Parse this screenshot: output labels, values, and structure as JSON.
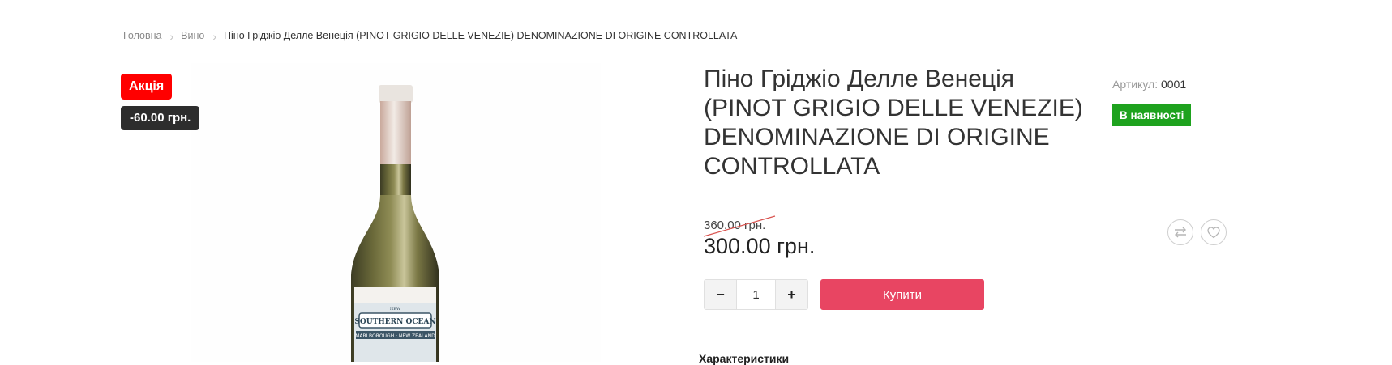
{
  "breadcrumb": {
    "home": "Головна",
    "category": "Вино",
    "current": "Піно Гріджіо Делле Венеція (PINOT GRIGIO DELLE VENEZIE) DENOMINAZIONE DI ORIGINE CONTROLLATA"
  },
  "badges": {
    "sale": "Акція",
    "discount": "-60.00 грн."
  },
  "product": {
    "title": "Піно Гріджіо Делле Венеція (PINOT GRIGIO DELLE VENEZIE) DENOMINAZIONE DI ORIGINE CONTROLLATA",
    "article_label": "Артикул:",
    "article_value": "0001",
    "stock_status": "В наявності",
    "old_price": "360.00 грн.",
    "new_price": "300.00 грн."
  },
  "cart": {
    "minus": "−",
    "plus": "+",
    "quantity": "1",
    "buy_label": "Купити"
  },
  "section": {
    "characteristics": "Характеристики"
  },
  "colors": {
    "sale_badge": "#ff0000",
    "discount_badge": "#2d2d2d",
    "stock_badge": "#1ea21e",
    "buy_button": "#e84562",
    "strike_line": "#d9534f"
  },
  "icons": {
    "compare": "compare-arrows-icon",
    "wishlist": "heart-icon",
    "breadcrumb_separator": "chevron-right-icon"
  }
}
